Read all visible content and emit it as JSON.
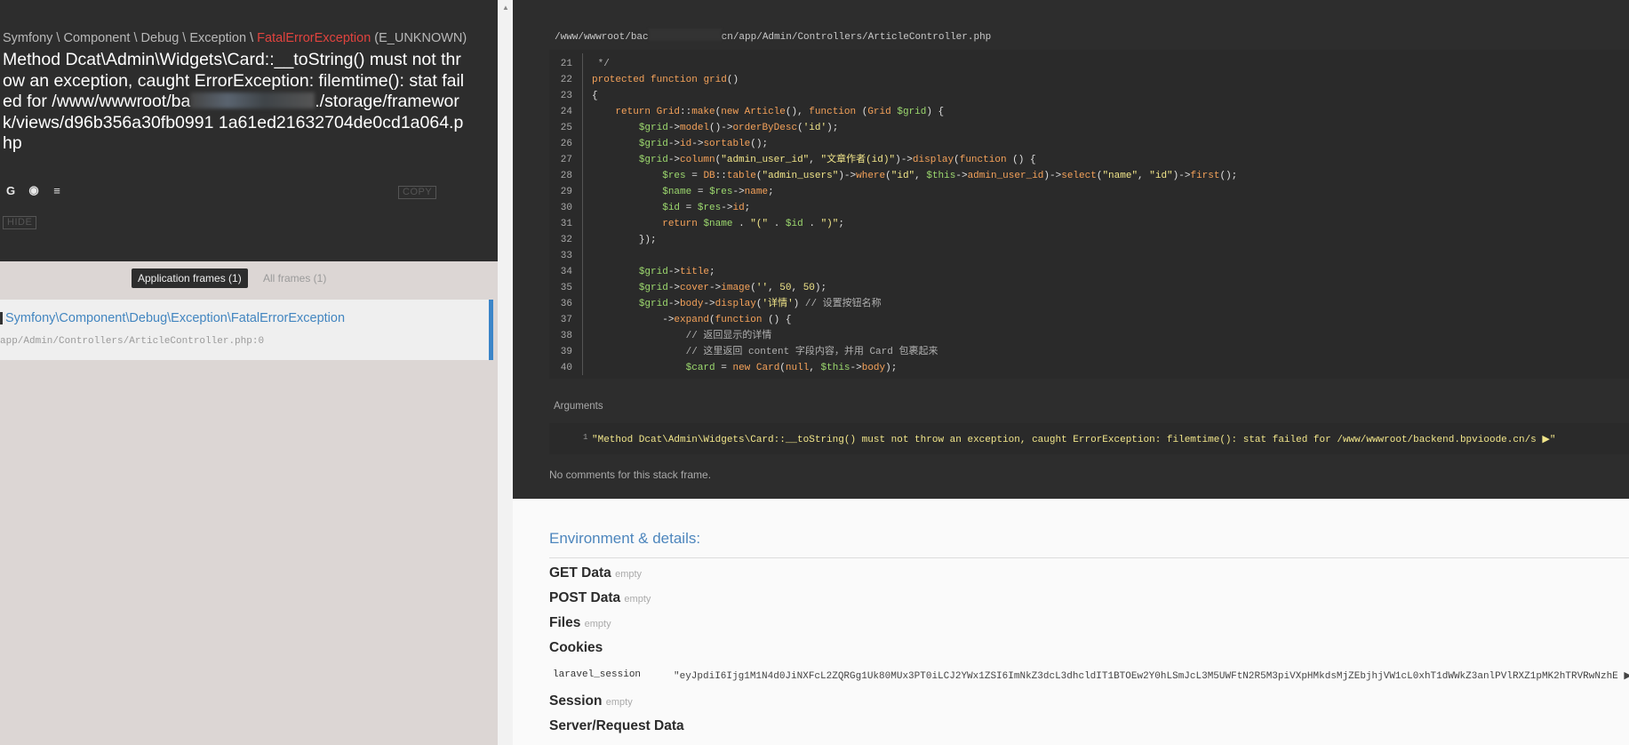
{
  "exception": {
    "class_prefix": "Symfony \\ Component \\ Debug \\ Exception \\ ",
    "class_name": "FatalErrorException",
    "code": " (E_UNKNOWN)",
    "message_part1": "Method Dcat\\Admin\\Widgets\\Card::__toString() must not throw an exception, caught ErrorException: filemtime(): stat failed for /www/wwwroot/ba",
    "message_part2": "./storage/framework/views/d96b356a30fb0991 1a61ed21632704de0cd1a064.php",
    "copy_label": "COPY",
    "hide_label": "HIDE",
    "icons": [
      "google-icon",
      "duckduckgo-icon",
      "stackoverflow-icon"
    ]
  },
  "frames": {
    "tab_app": "Application frames (1)",
    "tab_all": "All frames (1)",
    "items": [
      {
        "class": "Symfony\\Component\\Debug\\Exception\\FatalErrorException",
        "file": "app/Admin/Controllers/ArticleController.php:0"
      }
    ]
  },
  "code_view": {
    "file_path_start": "/www/wwwroot/bac",
    "file_path_end": "cn/app/Admin/Controllers/ArticleController.php",
    "lines": [
      {
        "n": "21",
        "html": "<span class=\"c\"> */</span>"
      },
      {
        "n": "22",
        "html": "<span class=\"k\">protected function</span> <span class=\"f\">grid</span><span class=\"w\">()</span>"
      },
      {
        "n": "23",
        "html": "<span class=\"w\">{</span>"
      },
      {
        "n": "24",
        "html": "    <span class=\"k\">return</span> <span class=\"f\">Grid</span><span class=\"w\">::</span><span class=\"f\">make</span><span class=\"w\">(</span><span class=\"k\">new</span> <span class=\"f\">Article</span><span class=\"w\">(), </span><span class=\"k\">function</span> <span class=\"w\">(</span><span class=\"f\">Grid</span> <span class=\"v\">$grid</span><span class=\"w\">) {</span>"
      },
      {
        "n": "25",
        "html": "        <span class=\"v\">$grid</span><span class=\"w\">-&gt;</span><span class=\"f\">model</span><span class=\"w\">()-&gt;</span><span class=\"f\">orderByDesc</span><span class=\"w\">(</span><span class=\"s\">'id'</span><span class=\"w\">);</span>"
      },
      {
        "n": "26",
        "html": "        <span class=\"v\">$grid</span><span class=\"w\">-&gt;</span><span class=\"f\">id</span><span class=\"w\">-&gt;</span><span class=\"f\">sortable</span><span class=\"w\">();</span>"
      },
      {
        "n": "27",
        "html": "        <span class=\"v\">$grid</span><span class=\"w\">-&gt;</span><span class=\"f\">column</span><span class=\"w\">(</span><span class=\"s\">\"admin_user_id\"</span><span class=\"w\">, </span><span class=\"s\">\"文章作者(id)\"</span><span class=\"w\">)-&gt;</span><span class=\"f\">display</span><span class=\"w\">(</span><span class=\"k\">function</span> <span class=\"w\">() {</span>"
      },
      {
        "n": "28",
        "html": "            <span class=\"v\">$res</span> <span class=\"w\">=</span> <span class=\"f\">DB</span><span class=\"w\">::</span><span class=\"f\">table</span><span class=\"w\">(</span><span class=\"s\">\"admin_users\"</span><span class=\"w\">)-&gt;</span><span class=\"f\">where</span><span class=\"w\">(</span><span class=\"s\">\"id\"</span><span class=\"w\">, </span><span class=\"v\">$this</span><span class=\"w\">-&gt;</span><span class=\"f\">admin_user_id</span><span class=\"w\">)-&gt;</span><span class=\"f\">select</span><span class=\"w\">(</span><span class=\"s\">\"name\"</span><span class=\"w\">, </span><span class=\"s\">\"id\"</span><span class=\"w\">)-&gt;</span><span class=\"f\">first</span><span class=\"w\">();</span>"
      },
      {
        "n": "29",
        "html": "            <span class=\"v\">$name</span> <span class=\"w\">=</span> <span class=\"v\">$res</span><span class=\"w\">-&gt;</span><span class=\"f\">name</span><span class=\"w\">;</span>"
      },
      {
        "n": "30",
        "html": "            <span class=\"v\">$id</span> <span class=\"w\">=</span> <span class=\"v\">$res</span><span class=\"w\">-&gt;</span><span class=\"f\">id</span><span class=\"w\">;</span>"
      },
      {
        "n": "31",
        "html": "            <span class=\"k\">return</span> <span class=\"v\">$name</span> <span class=\"w\">.</span> <span class=\"s\">\"(\"</span> <span class=\"w\">.</span> <span class=\"v\">$id</span> <span class=\"w\">.</span> <span class=\"s\">\")\"</span><span class=\"w\">;</span>"
      },
      {
        "n": "32",
        "html": "        <span class=\"w\">});</span>"
      },
      {
        "n": "33",
        "html": ""
      },
      {
        "n": "34",
        "html": "        <span class=\"v\">$grid</span><span class=\"w\">-&gt;</span><span class=\"f\">title</span><span class=\"w\">;</span>"
      },
      {
        "n": "35",
        "html": "        <span class=\"v\">$grid</span><span class=\"w\">-&gt;</span><span class=\"f\">cover</span><span class=\"w\">-&gt;</span><span class=\"f\">image</span><span class=\"w\">(</span><span class=\"s\">''</span><span class=\"w\">, </span><span class=\"n\">50</span><span class=\"w\">, </span><span class=\"n\">50</span><span class=\"w\">);</span>"
      },
      {
        "n": "36",
        "html": "        <span class=\"v\">$grid</span><span class=\"w\">-&gt;</span><span class=\"f\">body</span><span class=\"w\">-&gt;</span><span class=\"f\">display</span><span class=\"w\">(</span><span class=\"s\">'详情'</span><span class=\"w\">) </span><span class=\"c\">// 设置按钮名称</span>"
      },
      {
        "n": "37",
        "html": "            <span class=\"w\">-&gt;</span><span class=\"f\">expand</span><span class=\"w\">(</span><span class=\"k\">function</span> <span class=\"w\">() {</span>"
      },
      {
        "n": "38",
        "html": "                <span class=\"c\">// 返回显示的详情</span>"
      },
      {
        "n": "39",
        "html": "                <span class=\"c\">// 这里返回 content 字段内容，并用 Card 包裹起来</span>"
      },
      {
        "n": "40",
        "html": "                <span class=\"v\">$card</span> <span class=\"w\">=</span> <span class=\"k\">new</span> <span class=\"f\">Card</span><span class=\"w\">(</span><span class=\"k\">null</span><span class=\"w\">, </span><span class=\"v\">$this</span><span class=\"w\">-&gt;</span><span class=\"f\">body</span><span class=\"w\">);</span>"
      }
    ],
    "args_label": "Arguments",
    "args_index": "1",
    "args_value": "\"Method Dcat\\Admin\\Widgets\\Card::__toString() must not throw an exception, caught ErrorException: filemtime(): stat failed for /www/wwwroot/backend.bpvioode.cn/s ▶\"",
    "no_comments": "No comments for this stack frame."
  },
  "environment": {
    "title": "Environment & details:",
    "empty_label": "empty",
    "sections": [
      {
        "label": "GET Data",
        "empty": true
      },
      {
        "label": "POST Data",
        "empty": true
      },
      {
        "label": "Files",
        "empty": true
      },
      {
        "label": "Cookies",
        "empty": false
      },
      {
        "label": "Session",
        "empty": true
      },
      {
        "label": "Server/Request Data",
        "empty": false
      }
    ],
    "cookie_key": "laravel_session",
    "cookie_value": "\"eyJpdiI6Ijg1M1N4d0JiNXFcL2ZQRGg1Uk80MUx3PT0iLCJ2YWx1ZSI6ImNkZ3dcL3dhcldIT1BTOEw2Y0hLSmJcL3M5UWFtN2R5M3piVXpHMkdsMjZEbjhjVW1cL0xhT1dWWkZ3anlPVlRXZ1pMK2hTRVRwNzhE ▶"
  }
}
